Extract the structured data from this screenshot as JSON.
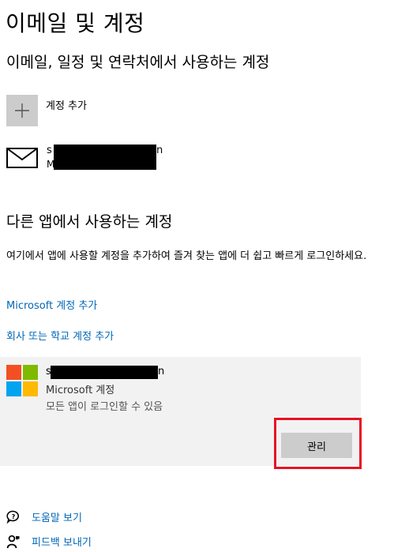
{
  "page": {
    "title": "이메일 및 계정"
  },
  "email_section": {
    "title": "이메일, 일정 및 연락처에서 사용하는 계정",
    "add_account_label": "계정 추가",
    "account": {
      "line1_visible": "s",
      "line1_suffix": "n",
      "line2_visible": "M"
    }
  },
  "other_apps_section": {
    "title": "다른 앱에서 사용하는 계정",
    "description": "여기에서 앱에 사용할 계정을 추가하여 즐겨 찾는 앱에 더 쉽고 빠르게 로그인하세요.",
    "add_microsoft_link": "Microsoft 계정 추가",
    "add_work_link": "회사 또는 학교 계정 추가",
    "account": {
      "email_visible": "s",
      "email_suffix": "n",
      "type": "Microsoft 계정",
      "status": "모든 앱이 로그인할 수 있음",
      "manage_label": "관리"
    }
  },
  "footer": {
    "help_label": "도움말 보기",
    "feedback_label": "피드백 보내기"
  },
  "colors": {
    "link": "#0067b8",
    "highlight": "#e81123",
    "ms_red": "#f25022",
    "ms_green": "#7fba00",
    "ms_blue": "#00a4ef",
    "ms_yellow": "#ffb900"
  }
}
